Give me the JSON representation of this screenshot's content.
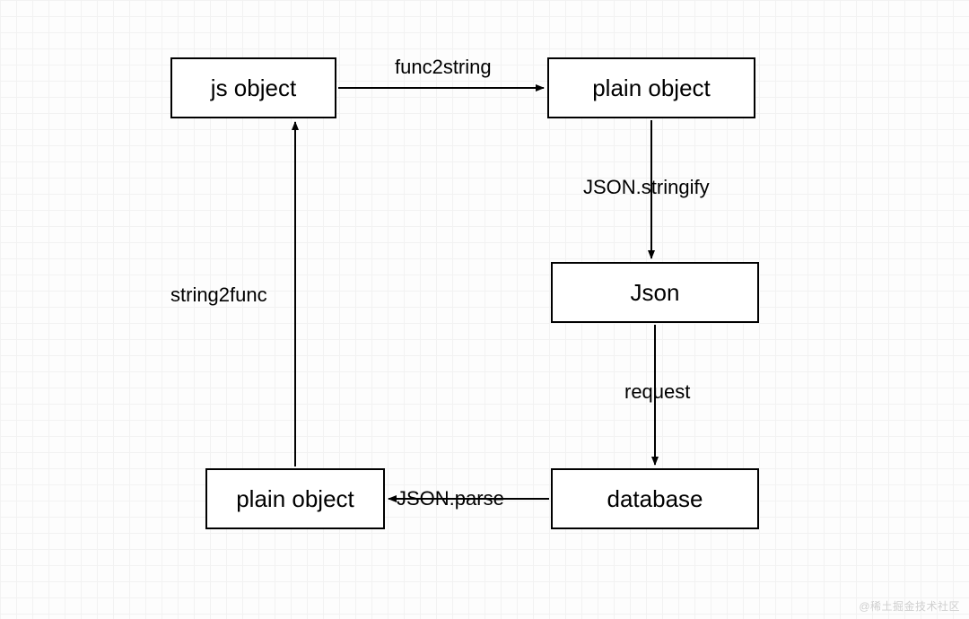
{
  "nodes": {
    "js_object": {
      "label": "js object"
    },
    "plain_object_1": {
      "label": "plain object"
    },
    "json": {
      "label": "Json"
    },
    "database": {
      "label": "database"
    },
    "plain_object_2": {
      "label": "plain object"
    }
  },
  "edges": {
    "func2string": {
      "label": "func2string"
    },
    "json_stringify": {
      "label": "JSON.stringify"
    },
    "request": {
      "label": "request"
    },
    "json_parse": {
      "label": "JSON.parse"
    },
    "string2func": {
      "label": "string2func"
    }
  },
  "watermark": "@稀土掘金技术社区"
}
